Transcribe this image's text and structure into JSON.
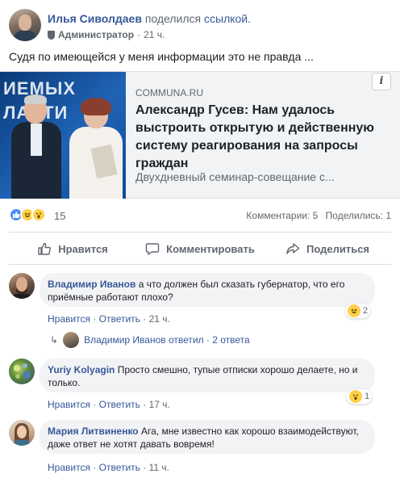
{
  "post": {
    "author": "Илья Сиволдаев",
    "shared_text": "поделился",
    "shared_link": "ссылкой.",
    "role": "Администратор",
    "time": "21 ч.",
    "text": "Судя по имеющейся у меня информации это не правда ..."
  },
  "link_card": {
    "thumb_text_line1": "ИЕМЫХ",
    "thumb_text_line2": "ЛАСТИ",
    "domain": "COMMUNA.RU",
    "title": "Александр Гусев: Нам удалось выстроить открытую и действенную систему реагирования на запросы граждан",
    "description": "Двухдневный семинар-совещание с...",
    "info_label": "i"
  },
  "stats": {
    "reaction_icons": [
      "like-icon",
      "haha-icon",
      "wow-icon"
    ],
    "reaction_count": "15",
    "comments": "Комментарии: 5",
    "shares": "Поделились: 1"
  },
  "actions": {
    "like": "Нравится",
    "comment": "Комментировать",
    "share": "Поделиться"
  },
  "comments": [
    {
      "author": "Владимир Иванов",
      "text": "а что должен был сказать губернатор, что его приёмные работают плохо?",
      "like": "Нравится",
      "reply": "Ответить",
      "time": "21 ч.",
      "reaction_icon": "haha-icon",
      "reaction_count": "2"
    },
    {
      "author": "Yuriy Kolyagin",
      "text": "Просто смешно, тупые отписки хорошо делаете, но и только.",
      "like": "Нравится",
      "reply": "Ответить",
      "time": "17 ч.",
      "reaction_icon": "wow-icon",
      "reaction_count": "1"
    },
    {
      "author": "Мария Литвиненко",
      "text": "Ага, мне известно как хорошо взаимодействуют, даже ответ не хотят давать вовремя!",
      "like": "Нравится",
      "reply": "Ответить",
      "time": "11 ч."
    }
  ],
  "reply_thread": {
    "text": "Владимир Иванов ответил · 2 ответа"
  },
  "colors": {
    "link_blue": "#385898",
    "secondary_text": "#606770",
    "bubble_bg": "#f2f3f5",
    "like_blue": "#4a8df8",
    "emoji_yellow": "#ffd04a"
  }
}
